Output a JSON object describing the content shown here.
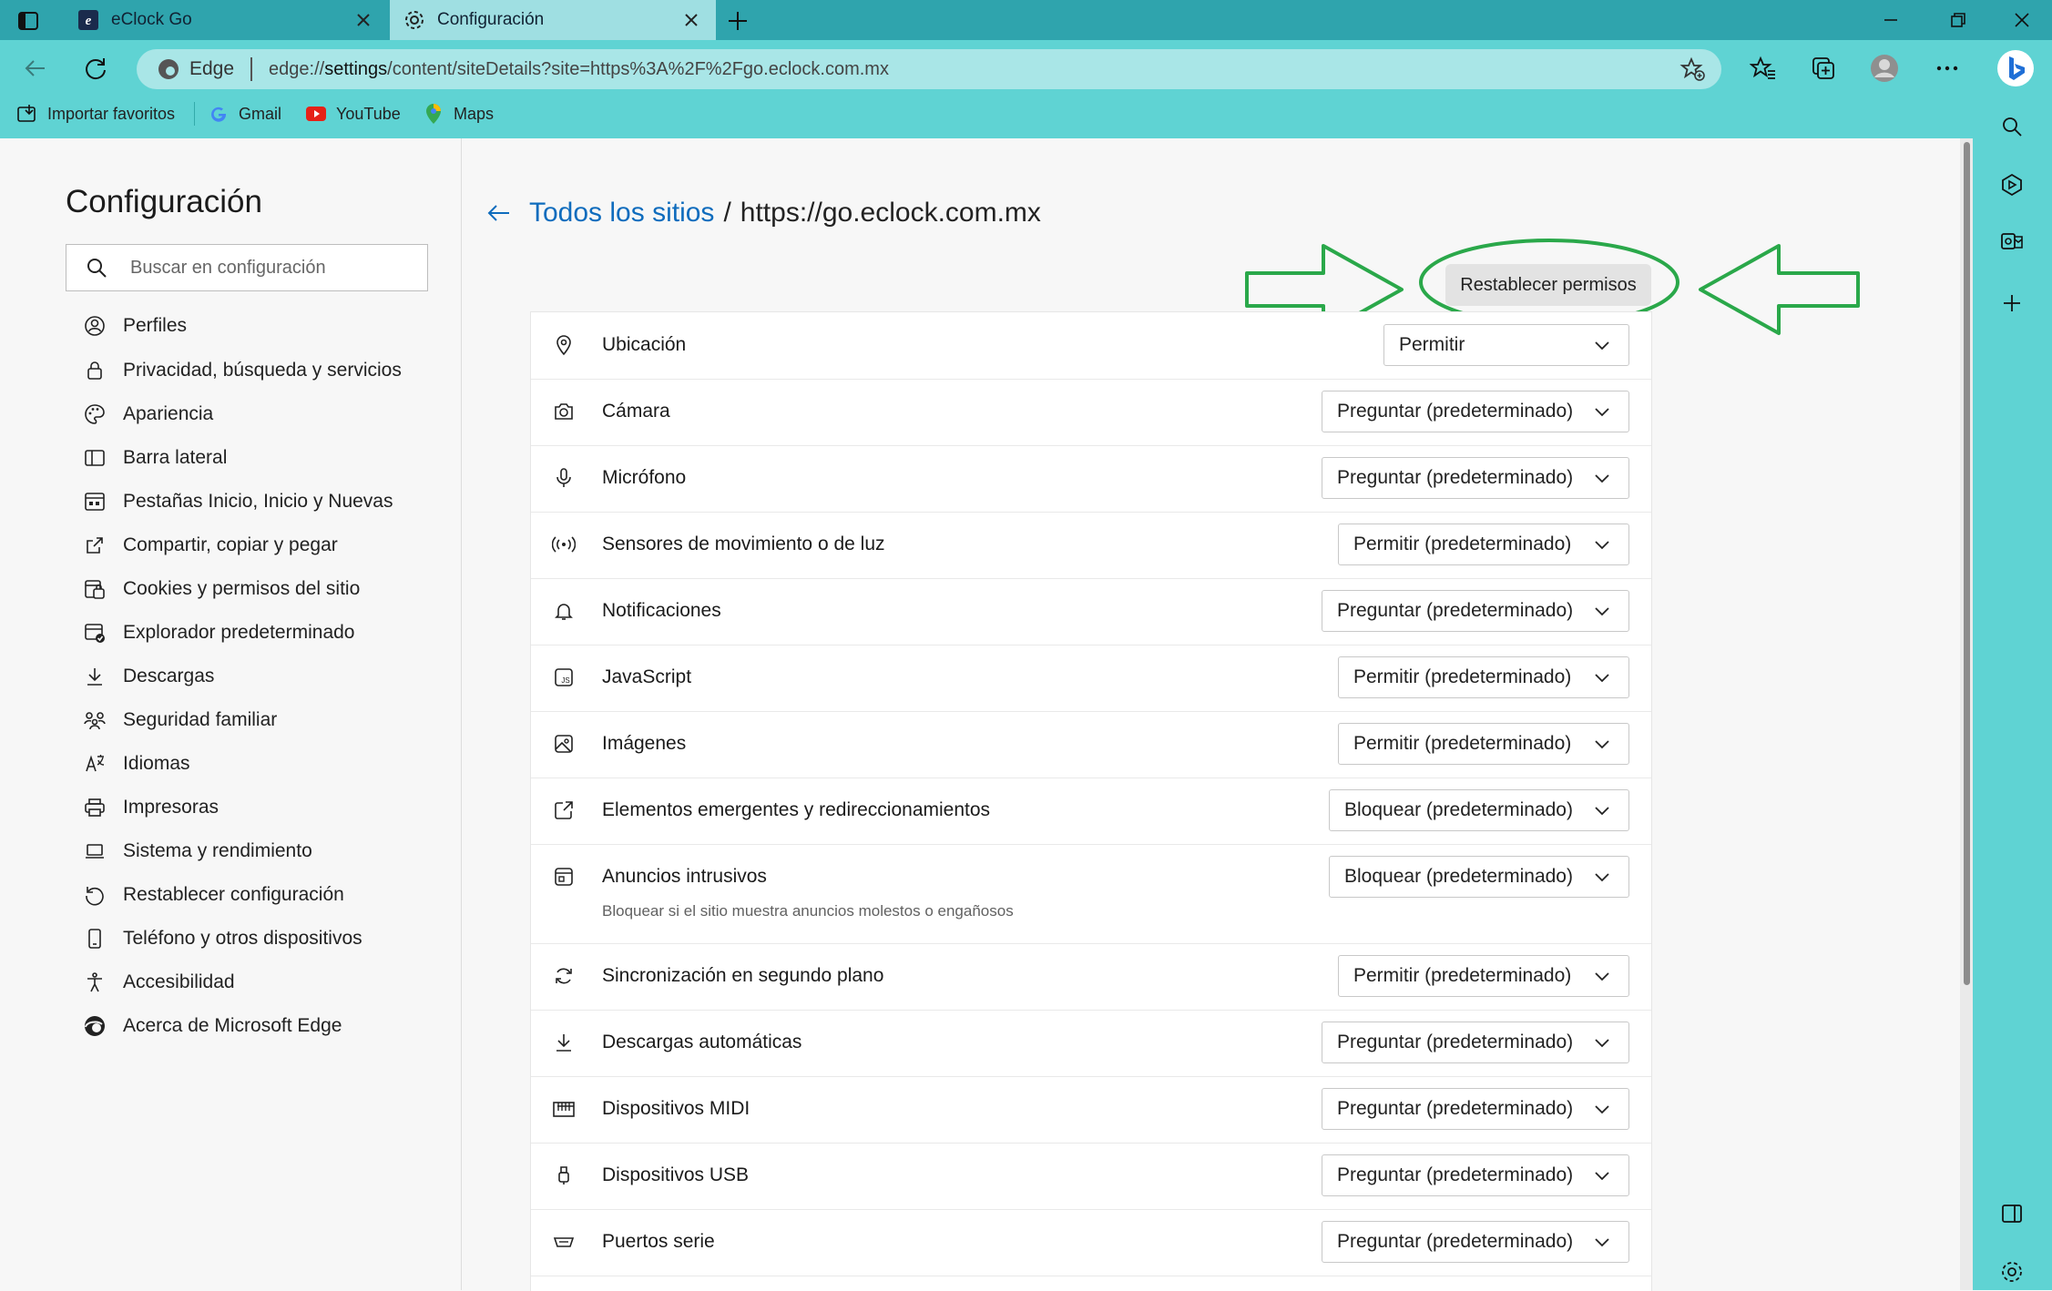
{
  "tabs": [
    {
      "label": "eClock Go",
      "icon": "eclock-favicon-icon"
    },
    {
      "label": "Configuración",
      "icon": "gear-icon"
    }
  ],
  "address_bar": {
    "brand": "Edge",
    "url_prefix": "edge://",
    "url_host": "settings",
    "url_rest": "/content/siteDetails?site=https%3A%2F%2Fgo.eclock.com.mx"
  },
  "bookmarks": [
    {
      "label": "Importar favoritos",
      "icon": "import-favorites-icon"
    },
    {
      "label": "Gmail",
      "icon": "google-icon"
    },
    {
      "label": "YouTube",
      "icon": "youtube-icon"
    },
    {
      "label": "Maps",
      "icon": "maps-pin-icon"
    }
  ],
  "settings": {
    "title": "Configuración",
    "search_placeholder": "Buscar en configuración",
    "nav": [
      {
        "label": "Perfiles",
        "icon": "profile-icon"
      },
      {
        "label": "Privacidad, búsqueda y servicios",
        "icon": "lock-icon"
      },
      {
        "label": "Apariencia",
        "icon": "palette-icon"
      },
      {
        "label": "Barra lateral",
        "icon": "sidebar-icon"
      },
      {
        "label": "Pestañas Inicio, Inicio y Nuevas",
        "icon": "home-tabs-icon"
      },
      {
        "label": "Compartir, copiar y pegar",
        "icon": "share-icon"
      },
      {
        "label": "Cookies y permisos del sitio",
        "icon": "cookies-icon"
      },
      {
        "label": "Explorador predeterminado",
        "icon": "default-browser-icon"
      },
      {
        "label": "Descargas",
        "icon": "download-icon"
      },
      {
        "label": "Seguridad familiar",
        "icon": "family-icon"
      },
      {
        "label": "Idiomas",
        "icon": "languages-icon"
      },
      {
        "label": "Impresoras",
        "icon": "printer-icon"
      },
      {
        "label": "Sistema y rendimiento",
        "icon": "laptop-icon"
      },
      {
        "label": "Restablecer configuración",
        "icon": "reset-icon"
      },
      {
        "label": "Teléfono y otros dispositivos",
        "icon": "phone-icon"
      },
      {
        "label": "Accesibilidad",
        "icon": "accessibility-icon"
      },
      {
        "label": "Acerca de Microsoft Edge",
        "icon": "edge-logo-icon"
      }
    ]
  },
  "breadcrumb": {
    "link": "Todos los sitios",
    "separator": "/",
    "site": "https://go.eclock.com.mx"
  },
  "reset_button": "Restablecer permisos",
  "permissions": [
    {
      "label": "Ubicación",
      "value": "Permitir",
      "icon": "location-icon"
    },
    {
      "label": "Cámara",
      "value": "Preguntar (predeterminado)",
      "icon": "camera-icon"
    },
    {
      "label": "Micrófono",
      "value": "Preguntar (predeterminado)",
      "icon": "microphone-icon"
    },
    {
      "label": "Sensores de movimiento o de luz",
      "value": "Permitir (predeterminado)",
      "icon": "sensors-icon"
    },
    {
      "label": "Notificaciones",
      "value": "Preguntar (predeterminado)",
      "icon": "bell-icon"
    },
    {
      "label": "JavaScript",
      "value": "Permitir (predeterminado)",
      "icon": "javascript-icon"
    },
    {
      "label": "Imágenes",
      "value": "Permitir (predeterminado)",
      "icon": "image-icon"
    },
    {
      "label": "Elementos emergentes y redireccionamientos",
      "value": "Bloquear (predeterminado)",
      "icon": "popup-icon"
    },
    {
      "label": "Anuncios intrusivos",
      "value": "Bloquear (predeterminado)",
      "icon": "ads-icon",
      "sub": "Bloquear si el sitio muestra anuncios molestos o engañosos"
    },
    {
      "label": "Sincronización en segundo plano",
      "value": "Permitir (predeterminado)",
      "icon": "sync-icon"
    },
    {
      "label": "Descargas automáticas",
      "value": "Preguntar (predeterminado)",
      "icon": "download-icon"
    },
    {
      "label": "Dispositivos MIDI",
      "value": "Preguntar (predeterminado)",
      "icon": "midi-icon"
    },
    {
      "label": "Dispositivos USB",
      "value": "Preguntar (predeterminado)",
      "icon": "usb-icon"
    },
    {
      "label": "Puertos serie",
      "value": "Preguntar (predeterminado)",
      "icon": "serial-port-icon"
    }
  ],
  "colors": {
    "tabstrip": "#2fa4ad",
    "toolbar": "#5fd3d3",
    "link": "#0f6cbd",
    "annotation": "#2aa84a"
  }
}
